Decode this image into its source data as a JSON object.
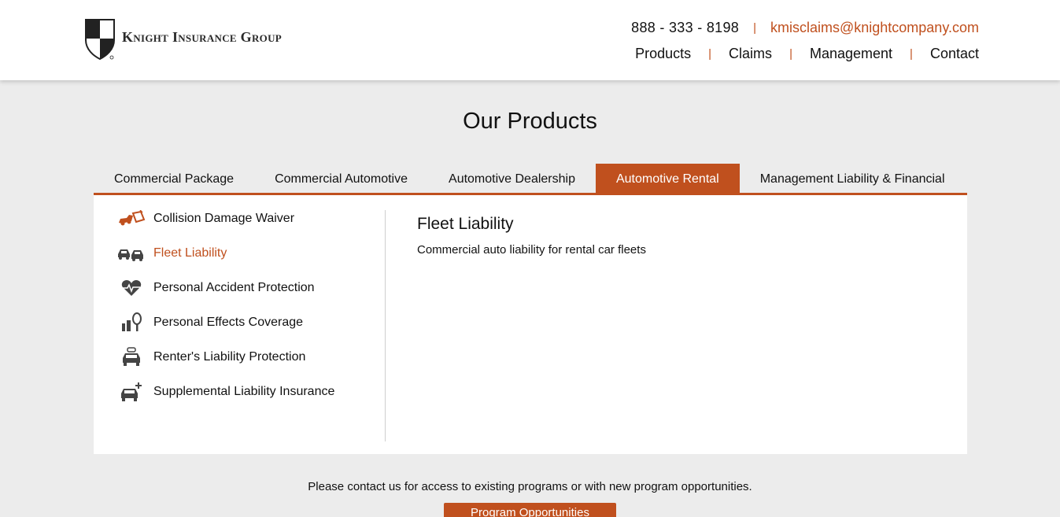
{
  "header": {
    "logo_text": "Knight Insurance Group",
    "phone": "888 - 333 - 8198",
    "separator": "|",
    "email": "kmisclaims@knightcompany.com",
    "nav": [
      {
        "label": "Products"
      },
      {
        "label": "Claims"
      },
      {
        "label": "Management"
      },
      {
        "label": "Contact"
      }
    ]
  },
  "page_title": "Our Products",
  "tabs": [
    {
      "label": "Commercial Package",
      "active": false
    },
    {
      "label": "Commercial Automotive",
      "active": false
    },
    {
      "label": "Automotive Dealership",
      "active": false
    },
    {
      "label": "Automotive Rental",
      "active": true
    },
    {
      "label": "Management Liability & Financial",
      "active": false
    }
  ],
  "products": [
    {
      "label": "Collision Damage Waiver",
      "icon": "car-crash-icon",
      "active": false
    },
    {
      "label": "Fleet Liability",
      "icon": "car-fleet-icon",
      "active": true
    },
    {
      "label": "Personal Accident Protection",
      "icon": "heartbeat-icon",
      "active": false
    },
    {
      "label": "Personal Effects Coverage",
      "icon": "personal-items-icon",
      "active": false
    },
    {
      "label": "Renter's Liability Protection",
      "icon": "taxi-car-icon",
      "active": false
    },
    {
      "label": "Supplemental Liability Insurance",
      "icon": "car-plus-icon",
      "active": false
    }
  ],
  "detail": {
    "title": "Fleet Liability",
    "description": "Commercial auto liability for rental car fleets"
  },
  "footer": {
    "contact_text": "Please contact us for access to existing programs or with new program opportunities.",
    "button_label": "Program Opportunities"
  },
  "colors": {
    "accent": "#c0501e",
    "background": "#ececec",
    "panel": "#ffffff"
  }
}
